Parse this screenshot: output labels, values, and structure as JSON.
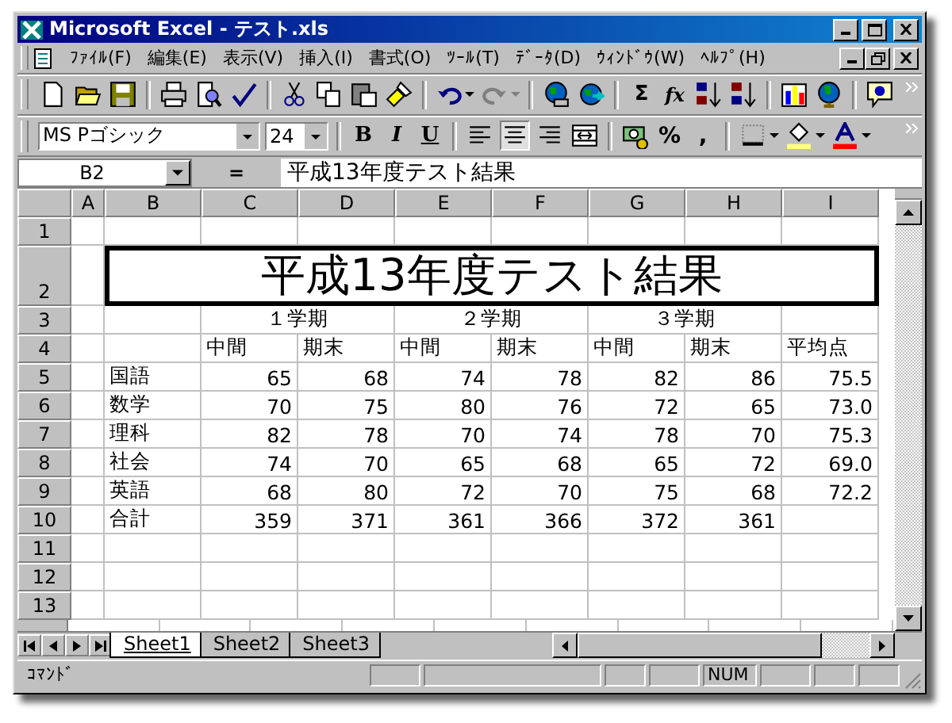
{
  "window": {
    "title": "Microsoft Excel - テスト.xls"
  },
  "menu": [
    {
      "label": "ﾌｧｲﾙ(F)"
    },
    {
      "label": "編集(E)"
    },
    {
      "label": "表示(V)"
    },
    {
      "label": "挿入(I)"
    },
    {
      "label": "書式(O)"
    },
    {
      "label": "ﾂｰﾙ(T)"
    },
    {
      "label": "ﾃﾞｰﾀ(D)"
    },
    {
      "label": "ｳｨﾝﾄﾞｳ(W)"
    },
    {
      "label": "ﾍﾙﾌﾟ(H)"
    }
  ],
  "standard_toolbar": {
    "sum": "Σ",
    "function": "fx"
  },
  "formatting_toolbar": {
    "font": "MS Pゴシック",
    "size": "24",
    "style_buttons": [
      "B",
      "I",
      "U"
    ],
    "number_buttons": [
      "%",
      ","
    ]
  },
  "formula_bar": {
    "name_box": "B2",
    "equals": "=",
    "content": "平成13年度テスト結果"
  },
  "sheet": {
    "columns": [
      "A",
      "B",
      "C",
      "D",
      "E",
      "F",
      "G",
      "H",
      "I"
    ],
    "rows": [
      {
        "header": "1",
        "kind": "normal"
      },
      {
        "header": "2",
        "kind": "title",
        "cells": [
          {
            "selected": false
          },
          {
            "kind": "title",
            "text": "平成13年度テスト結果",
            "selected": true
          },
          {
            "kind": "covered"
          },
          {
            "kind": "covered"
          },
          {
            "kind": "covered"
          },
          {
            "kind": "covered"
          },
          {
            "kind": "covered"
          },
          {
            "kind": "covered"
          },
          {
            "kind": "covered"
          }
        ]
      },
      {
        "header": "3",
        "kind": "normal",
        "cells": [
          {
            "selected": false
          },
          {
            "selected": false
          },
          {
            "kind": "group",
            "text": "１学期",
            "selected": false
          },
          {
            "kind": "covered"
          },
          {
            "kind": "group",
            "text": "２学期",
            "selected": false
          },
          {
            "kind": "covered"
          },
          {
            "kind": "group",
            "text": "３学期",
            "selected": false
          },
          {
            "kind": "covered"
          },
          {
            "selected": false
          }
        ]
      },
      {
        "header": "4",
        "kind": "normal",
        "cells": [
          {
            "selected": false
          },
          {
            "selected": false
          },
          {
            "kind": "label",
            "text": "中間",
            "selected": false
          },
          {
            "kind": "label",
            "text": "期末",
            "selected": false
          },
          {
            "kind": "label",
            "text": "中間",
            "selected": false
          },
          {
            "kind": "label",
            "text": "期末",
            "selected": false
          },
          {
            "kind": "label",
            "text": "中間",
            "selected": false
          },
          {
            "kind": "label",
            "text": "期末",
            "selected": false
          },
          {
            "kind": "label",
            "text": "平均点",
            "selected": false
          }
        ]
      },
      {
        "header": "5",
        "kind": "normal",
        "cells": [
          {
            "selected": false
          },
          {
            "kind": "label",
            "text": "国語",
            "selected": false
          },
          {
            "kind": "number",
            "text": "65",
            "selected": false
          },
          {
            "kind": "number",
            "text": "68",
            "selected": false
          },
          {
            "kind": "number",
            "text": "74",
            "selected": false
          },
          {
            "kind": "number",
            "text": "78",
            "selected": false
          },
          {
            "kind": "number",
            "text": "82",
            "selected": false
          },
          {
            "kind": "number",
            "text": "86",
            "selected": false
          },
          {
            "kind": "number",
            "text": "75.5",
            "selected": false
          }
        ]
      },
      {
        "header": "6",
        "kind": "normal",
        "cells": [
          {
            "selected": false
          },
          {
            "kind": "label",
            "text": "数学",
            "selected": false
          },
          {
            "kind": "number",
            "text": "70",
            "selected": false
          },
          {
            "kind": "number",
            "text": "75",
            "selected": false
          },
          {
            "kind": "number",
            "text": "80",
            "selected": false
          },
          {
            "kind": "number",
            "text": "76",
            "selected": false
          },
          {
            "kind": "number",
            "text": "72",
            "selected": false
          },
          {
            "kind": "number",
            "text": "65",
            "selected": false
          },
          {
            "kind": "number",
            "text": "73.0",
            "selected": false
          }
        ]
      },
      {
        "header": "7",
        "kind": "normal",
        "cells": [
          {
            "selected": false
          },
          {
            "kind": "label",
            "text": "理科",
            "selected": false
          },
          {
            "kind": "number",
            "text": "82",
            "selected": false
          },
          {
            "kind": "number",
            "text": "78",
            "selected": false
          },
          {
            "kind": "number",
            "text": "70",
            "selected": false
          },
          {
            "kind": "number",
            "text": "74",
            "selected": false
          },
          {
            "kind": "number",
            "text": "78",
            "selected": false
          },
          {
            "kind": "number",
            "text": "70",
            "selected": false
          },
          {
            "kind": "number",
            "text": "75.3",
            "selected": false
          }
        ]
      },
      {
        "header": "8",
        "kind": "normal",
        "cells": [
          {
            "selected": false
          },
          {
            "kind": "label",
            "text": "社会",
            "selected": false
          },
          {
            "kind": "number",
            "text": "74",
            "selected": false
          },
          {
            "kind": "number",
            "text": "70",
            "selected": false
          },
          {
            "kind": "number",
            "text": "65",
            "selected": false
          },
          {
            "kind": "number",
            "text": "68",
            "selected": false
          },
          {
            "kind": "number",
            "text": "65",
            "selected": false
          },
          {
            "kind": "number",
            "text": "72",
            "selected": false
          },
          {
            "kind": "number",
            "text": "69.0",
            "selected": false
          }
        ]
      },
      {
        "header": "9",
        "kind": "normal",
        "cells": [
          {
            "selected": false
          },
          {
            "kind": "label",
            "text": "英語",
            "selected": false
          },
          {
            "kind": "number",
            "text": "68",
            "selected": false
          },
          {
            "kind": "number",
            "text": "80",
            "selected": false
          },
          {
            "kind": "number",
            "text": "72",
            "selected": false
          },
          {
            "kind": "number",
            "text": "70",
            "selected": false
          },
          {
            "kind": "number",
            "text": "75",
            "selected": false
          },
          {
            "kind": "number",
            "text": "68",
            "selected": false
          },
          {
            "kind": "number",
            "text": "72.2",
            "selected": false
          }
        ]
      },
      {
        "header": "10",
        "kind": "normal",
        "cells": [
          {
            "selected": false
          },
          {
            "kind": "label",
            "text": "合計",
            "selected": false
          },
          {
            "kind": "number",
            "text": "359",
            "selected": false
          },
          {
            "kind": "number",
            "text": "371",
            "selected": false
          },
          {
            "kind": "number",
            "text": "361",
            "selected": false
          },
          {
            "kind": "number",
            "text": "366",
            "selected": false
          },
          {
            "kind": "number",
            "text": "372",
            "selected": false
          },
          {
            "kind": "number",
            "text": "361",
            "selected": false
          },
          {
            "selected": false
          }
        ]
      },
      {
        "header": "11",
        "kind": "normal"
      },
      {
        "header": "12",
        "kind": "normal"
      },
      {
        "header": "13",
        "kind": "normal"
      }
    ]
  },
  "sheet_tabs": [
    {
      "label": "Sheet1",
      "selected": true
    },
    {
      "label": "Sheet2",
      "selected": false
    },
    {
      "label": "Sheet3",
      "selected": false
    }
  ],
  "status_bar": {
    "mode": "ｺﾏﾝﾄﾞ",
    "indicators": [
      {
        "text": "NUM"
      }
    ]
  }
}
